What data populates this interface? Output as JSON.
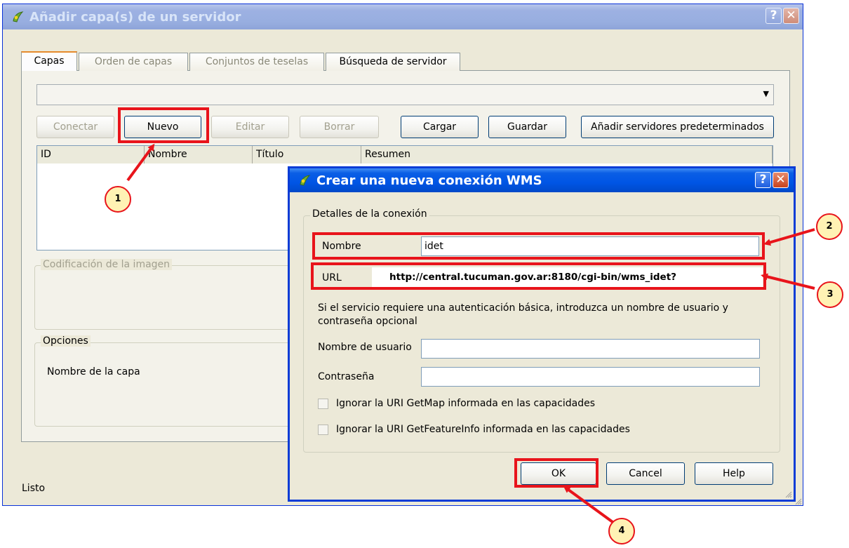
{
  "main_window": {
    "title": "Añadir capa(s) de un servidor",
    "help_glyph": "?",
    "close_glyph": "✕",
    "tabs": [
      {
        "label": "Capas",
        "active": true
      },
      {
        "label": "Orden de capas",
        "active": false
      },
      {
        "label": "Conjuntos de teselas",
        "active": false
      },
      {
        "label": "Búsqueda de servidor",
        "active": true
      }
    ],
    "combo_value": "",
    "combo_arrow": "▼",
    "buttons": {
      "conectar": "Conectar",
      "nuevo": "Nuevo",
      "editar": "Editar",
      "borrar": "Borrar",
      "cargar": "Cargar",
      "guardar": "Guardar",
      "predeterminados": "Añadir servidores predeterminados"
    },
    "table_headers": [
      "ID",
      "Nombre",
      "Título",
      "Resumen"
    ],
    "groups": {
      "imagen": "Codificación de la imagen",
      "opciones": "Opciones",
      "nombre_capa": "Nombre de la capa"
    },
    "status": "Listo"
  },
  "dialog": {
    "title": "Crear una nueva conexión WMS",
    "help_glyph": "?",
    "close_glyph": "✕",
    "group_label": "Detalles de la conexión",
    "nombre_label": "Nombre",
    "nombre_value": "idet",
    "url_label": "URL",
    "url_value": "http://central.tucuman.gov.ar:8180/cgi-bin/wms_idet?",
    "auth_text": "Si el servicio requiere una autenticación básica, introduzca un nombre de usuario y contraseña opcional",
    "usuario_label": "Nombre de usuario",
    "usuario_value": "",
    "password_label": "Contraseña",
    "password_value": "",
    "check_getmap": "Ignorar la URI GetMap informada en las capacidades",
    "check_getfeatureinfo": "Ignorar la URI GetFeatureInfo informada en las capacidades",
    "ok": "OK",
    "cancel": "Cancel",
    "help": "Help"
  },
  "annotations": [
    "1",
    "2",
    "3",
    "4"
  ],
  "colors": {
    "highlight": "#e8141b",
    "callout_fill": "#fff2b4",
    "xp_blue": "#0055e5"
  }
}
